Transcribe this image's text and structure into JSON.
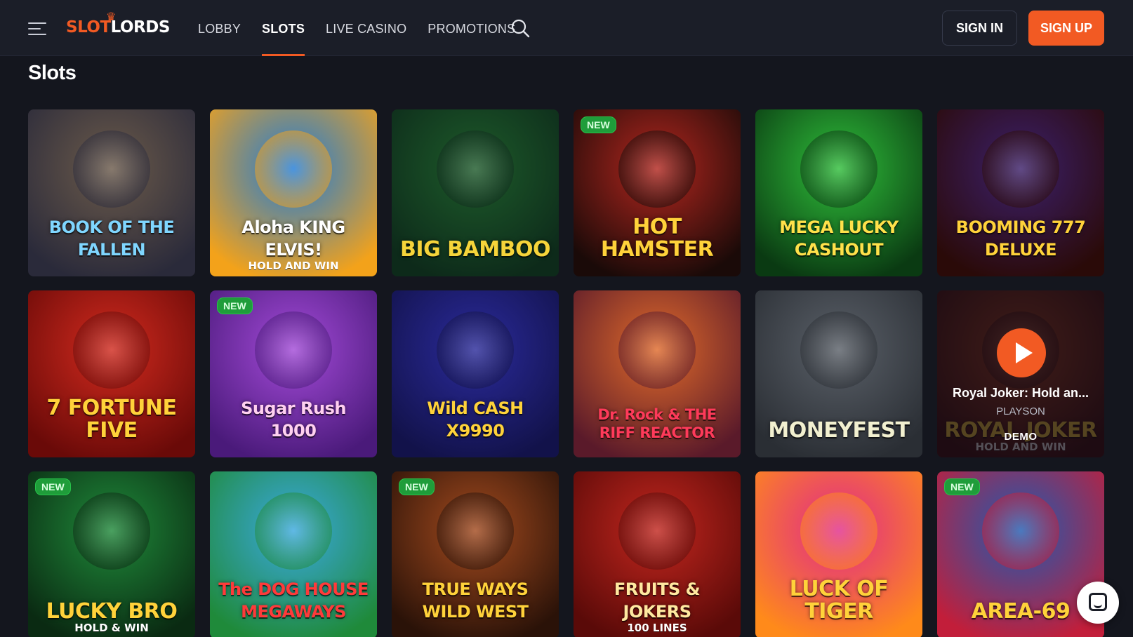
{
  "header": {
    "logo_slot": "SLOT",
    "logo_lords": "LORDS",
    "nav": [
      {
        "label": "LOBBY",
        "active": false
      },
      {
        "label": "SLOTS",
        "active": true
      },
      {
        "label": "LIVE CASINO",
        "active": false
      },
      {
        "label": "PROMOTIONS",
        "active": false
      }
    ],
    "signin_label": "SIGN IN",
    "signup_label": "SIGN UP"
  },
  "page": {
    "title": "Slots"
  },
  "badge_new": "NEW",
  "games": [
    {
      "title": "BOOK OF THE FALLEN",
      "subtitle": "",
      "new": false,
      "colors": [
        "#6b5a4a",
        "#2a2a3a"
      ],
      "title_color": "#7fd6ff"
    },
    {
      "title": "Aloha KING ELVIS!",
      "subtitle": "HOLD AND WIN",
      "new": false,
      "colors": [
        "#1e7bd8",
        "#f3a21a"
      ],
      "title_color": "#ffffff"
    },
    {
      "title": "BIG BAMBOO",
      "subtitle": "",
      "new": false,
      "colors": [
        "#1d5a2a",
        "#0d2a1a"
      ],
      "title_color": "#f6d43a"
    },
    {
      "title": "HOT HAMSTER",
      "subtitle": "",
      "new": true,
      "colors": [
        "#b3261e",
        "#1a0a08"
      ],
      "title_color": "#ffd23a"
    },
    {
      "title": "MEGA LUCKY CASHOUT",
      "subtitle": "",
      "new": false,
      "colors": [
        "#2fbf3a",
        "#0a3a12"
      ],
      "title_color": "#ffe14a"
    },
    {
      "title": "BOOMING 777 DELUXE",
      "subtitle": "",
      "new": false,
      "colors": [
        "#3b1f6a",
        "#2a0a08"
      ],
      "title_color": "#ffd23a"
    },
    {
      "title": "7 FORTUNE FIVE",
      "subtitle": "",
      "new": false,
      "colors": [
        "#d12a1e",
        "#6a0a08"
      ],
      "title_color": "#ffd23a"
    },
    {
      "title": "Sugar Rush 1000",
      "subtitle": "",
      "new": true,
      "colors": [
        "#a34ad8",
        "#4a1a7a"
      ],
      "title_color": "#ffd0f0"
    },
    {
      "title": "Wild CASH X9990",
      "subtitle": "",
      "new": false,
      "colors": [
        "#2a2a9a",
        "#12124a"
      ],
      "title_color": "#ffd23a"
    },
    {
      "title": "Dr. Rock & THE RIFF REACTOR",
      "subtitle": "",
      "new": false,
      "colors": [
        "#e06a2a",
        "#5a1a2a"
      ],
      "title_color": "#ff3a5a"
    },
    {
      "title": "MONEYFEST",
      "subtitle": "",
      "new": false,
      "colors": [
        "#5a6068",
        "#2a2e34"
      ],
      "title_color": "#f2f0d0"
    },
    {
      "title": "ROYAL JOKER",
      "subtitle": "HOLD AND WIN",
      "new": false,
      "colors": [
        "#b3461e",
        "#3a0a0a"
      ],
      "title_color": "#ffd23a",
      "hover": true
    },
    {
      "title": "LUCKY BRO",
      "subtitle": "HOLD & WIN",
      "new": true,
      "colors": [
        "#1f8a3a",
        "#0a2a12"
      ],
      "title_color": "#ffd23a"
    },
    {
      "title": "The DOG HOUSE MEGAWAYS",
      "subtitle": "",
      "new": false,
      "colors": [
        "#3aa8e0",
        "#1f8a3a"
      ],
      "title_color": "#ff3a3a"
    },
    {
      "title": "TRUE WAYS WILD WEST",
      "subtitle": "",
      "new": true,
      "colors": [
        "#a34a1e",
        "#2a1208"
      ],
      "title_color": "#ffd23a"
    },
    {
      "title": "FRUITS & JOKERS",
      "subtitle": "100 LINES",
      "new": false,
      "colors": [
        "#c2261e",
        "#5a0a08"
      ],
      "title_color": "#ffe8a0"
    },
    {
      "title": "LUCK OF TIGER",
      "subtitle": "",
      "new": false,
      "colors": [
        "#e02a8a",
        "#ff8a1a"
      ],
      "title_color": "#ffd23a"
    },
    {
      "title": "AREA-69",
      "subtitle": "",
      "new": true,
      "colors": [
        "#1f5ab0",
        "#c21e3a"
      ],
      "title_color": "#ffd23a"
    }
  ],
  "hover_card": {
    "title": "Royal Joker: Hold an...",
    "provider": "PLAYSON",
    "demo_label": "DEMO"
  }
}
